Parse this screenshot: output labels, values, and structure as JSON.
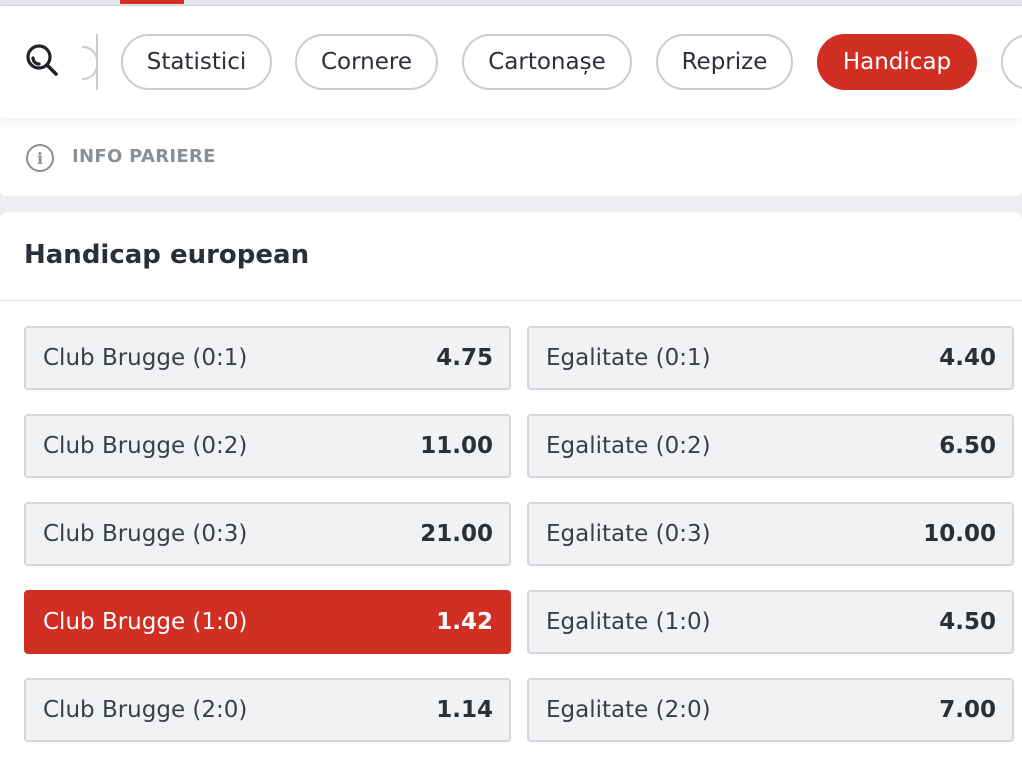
{
  "filters": {
    "search_icon": "search-icon",
    "chips": [
      {
        "label": "Statistici",
        "active": false
      },
      {
        "label": "Cornere",
        "active": false
      },
      {
        "label": "Cartonașe",
        "active": false
      },
      {
        "label": "Reprize",
        "active": false
      },
      {
        "label": "Handicap",
        "active": true
      }
    ]
  },
  "info": {
    "icon": "info-icon",
    "label": "INFO PARIERE"
  },
  "market": {
    "title": "Handicap european",
    "rows": [
      {
        "left": {
          "label": "Club Brugge (0:1)",
          "odds": "4.75",
          "selected": false
        },
        "right": {
          "label": "Egalitate (0:1)",
          "odds": "4.40",
          "selected": false
        }
      },
      {
        "left": {
          "label": "Club Brugge (0:2)",
          "odds": "11.00",
          "selected": false
        },
        "right": {
          "label": "Egalitate (0:2)",
          "odds": "6.50",
          "selected": false
        }
      },
      {
        "left": {
          "label": "Club Brugge (0:3)",
          "odds": "21.00",
          "selected": false
        },
        "right": {
          "label": "Egalitate (0:3)",
          "odds": "10.00",
          "selected": false
        }
      },
      {
        "left": {
          "label": "Club Brugge (1:0)",
          "odds": "1.42",
          "selected": true
        },
        "right": {
          "label": "Egalitate (1:0)",
          "odds": "4.50",
          "selected": false
        }
      },
      {
        "left": {
          "label": "Club Brugge (2:0)",
          "odds": "1.14",
          "selected": false
        },
        "right": {
          "label": "Egalitate (2:0)",
          "odds": "7.00",
          "selected": false
        }
      }
    ]
  },
  "colors": {
    "accent": "#d12e24",
    "text": "#2b2f36",
    "muted": "#8b9098"
  }
}
